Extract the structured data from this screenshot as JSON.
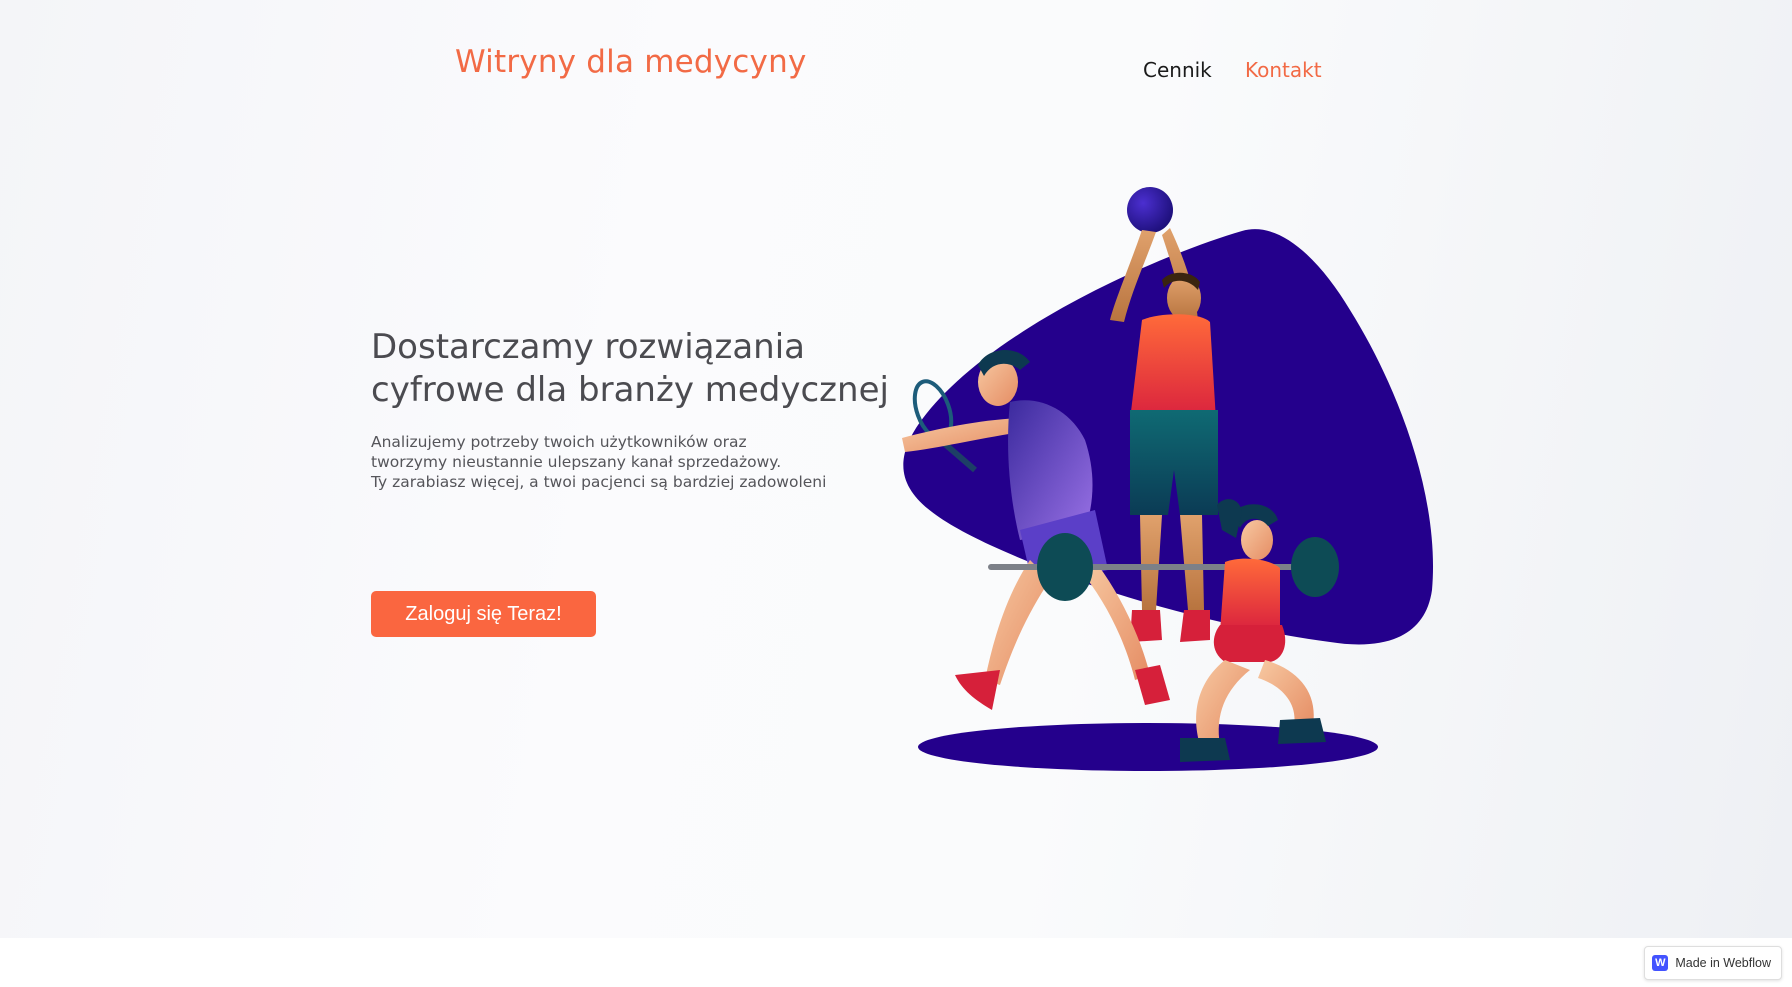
{
  "header": {
    "brand": "Witryny dla medycyny",
    "nav": [
      {
        "label": "Cennik"
      },
      {
        "label": "Kontakt"
      }
    ]
  },
  "hero": {
    "headline_lines": [
      "Dostarczamy rozwiązania",
      "cyfrowe dla branży medycznej"
    ],
    "sub_lines": [
      "Analizujemy potrzeby twoich użytkowników oraz",
      "tworzymy nieustannie ulepszany kanał sprzedażowy.",
      "Ty zarabiasz więcej, a twoi pacjenci są bardziej zadowoleni"
    ],
    "cta_label": "Zaloguj się Teraz!"
  },
  "badge": {
    "label": "Made in Webflow",
    "logo_letter": "W"
  },
  "colors": {
    "accent": "#f26a45",
    "button": "#fa6640",
    "illustration_blob": "#24008c"
  }
}
